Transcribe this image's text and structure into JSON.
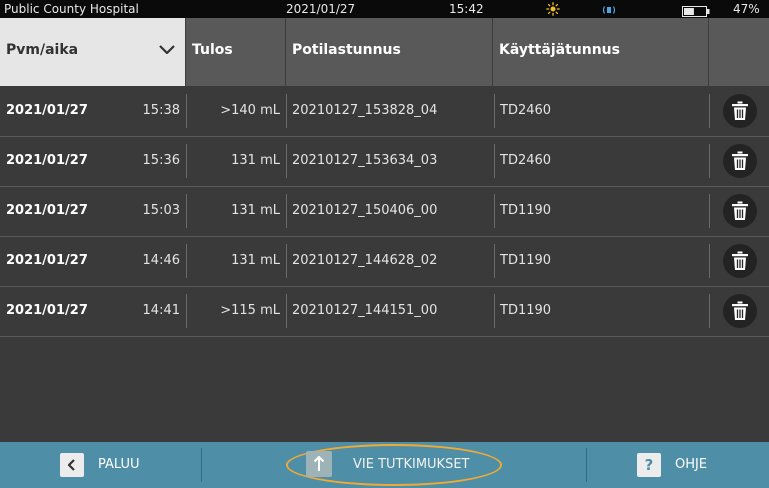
{
  "status_bar": {
    "hospital": "Public County Hospital",
    "date": "2021/01/27",
    "time": "15:42",
    "battery_percent": "47%",
    "battery_level": 0.47,
    "icons": [
      "sun-icon",
      "volume-icon",
      "battery-icon"
    ]
  },
  "header": {
    "sort_label": "Pvm/aika",
    "col_result": "Tulos",
    "col_patient": "Potilastunnus",
    "col_user": "Käyttäjätunnus"
  },
  "rows": [
    {
      "date": "2021/01/27",
      "time": "15:38",
      "result": ">140 mL",
      "patient": "20210127_153828_04",
      "user": "TD2460"
    },
    {
      "date": "2021/01/27",
      "time": "15:36",
      "result": "131 mL",
      "patient": "20210127_153634_03",
      "user": "TD2460"
    },
    {
      "date": "2021/01/27",
      "time": "15:03",
      "result": "131 mL",
      "patient": "20210127_150406_00",
      "user": "TD1190"
    },
    {
      "date": "2021/01/27",
      "time": "14:46",
      "result": "131 mL",
      "patient": "20210127_144628_02",
      "user": "TD1190"
    },
    {
      "date": "2021/01/27",
      "time": "14:41",
      "result": ">115 mL",
      "patient": "20210127_144151_00",
      "user": "TD1190"
    }
  ],
  "bottom": {
    "back_label": "PALUU",
    "export_label": "VIE TUTKIMUKSET",
    "help_symbol": "?",
    "help_label": "OHJE"
  },
  "colors": {
    "accent": "#4e8ea6",
    "highlight_ring": "#f0a935",
    "sun": "#f0c020",
    "volume": "#4aa8e0"
  }
}
